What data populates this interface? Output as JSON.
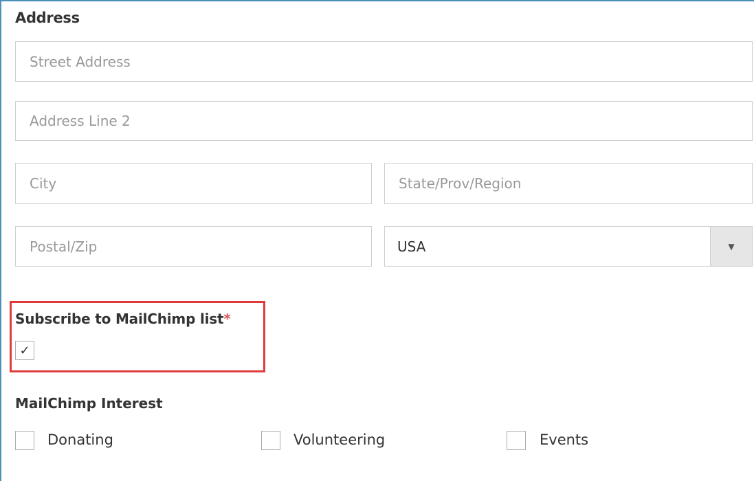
{
  "address": {
    "title": "Address",
    "street_placeholder": "Street Address",
    "line2_placeholder": "Address Line 2",
    "city_placeholder": "City",
    "state_placeholder": "State/Prov/Region",
    "postal_placeholder": "Postal/Zip",
    "country_selected": "USA",
    "country_arrow_icon": "caret-down-icon"
  },
  "subscribe": {
    "label": "Subscribe to MailChimp list",
    "required_marker": "*",
    "checked": true,
    "check_glyph": "✓"
  },
  "interest": {
    "title": "MailChimp Interest",
    "options": [
      {
        "label": "Donating",
        "checked": false
      },
      {
        "label": "Volunteering",
        "checked": false
      },
      {
        "label": "Events",
        "checked": false
      }
    ]
  },
  "colors": {
    "frame_border": "#4a90b8",
    "highlight_border": "#e03a3a",
    "required": "#d9534f"
  }
}
